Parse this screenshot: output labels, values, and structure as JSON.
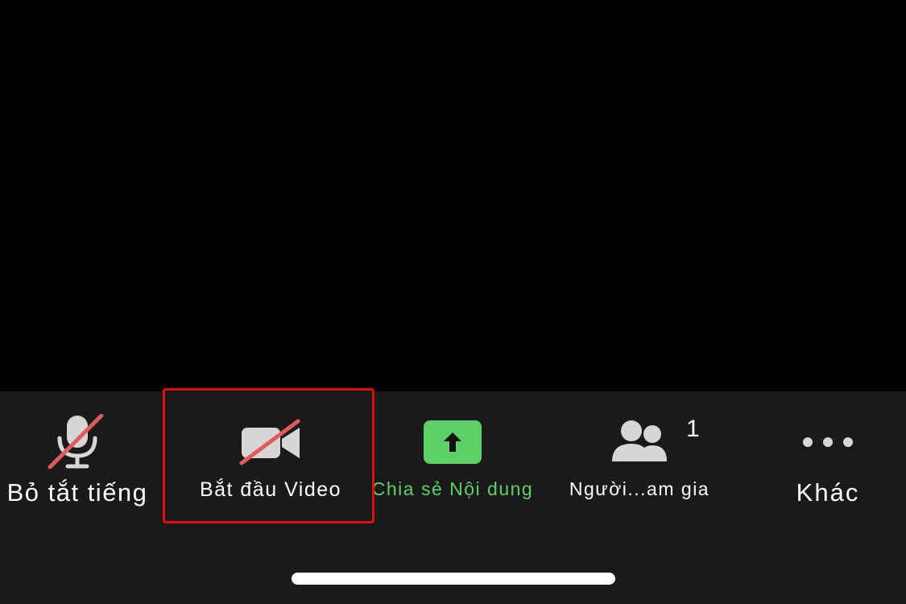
{
  "toolbar": {
    "mute": {
      "label": "Bỏ tắt tiếng",
      "icon": "mic-off-icon"
    },
    "video": {
      "label": "Bắt đầu Video",
      "icon": "video-off-icon"
    },
    "share": {
      "label": "Chia sẻ Nội dung",
      "icon": "share-arrow-up-icon"
    },
    "participants": {
      "label": "Người...am gia",
      "icon": "participants-icon",
      "count": "1"
    },
    "more": {
      "label": "Khác",
      "icon": "more-dots-icon"
    }
  },
  "colors": {
    "background": "#000000",
    "toolbar": "#1a1a1a",
    "icon_gray": "#d6d6d6",
    "strike_red": "#e35a5a",
    "share_green": "#5dd068",
    "highlight_red": "#e01010",
    "text_white": "#ffffff"
  }
}
